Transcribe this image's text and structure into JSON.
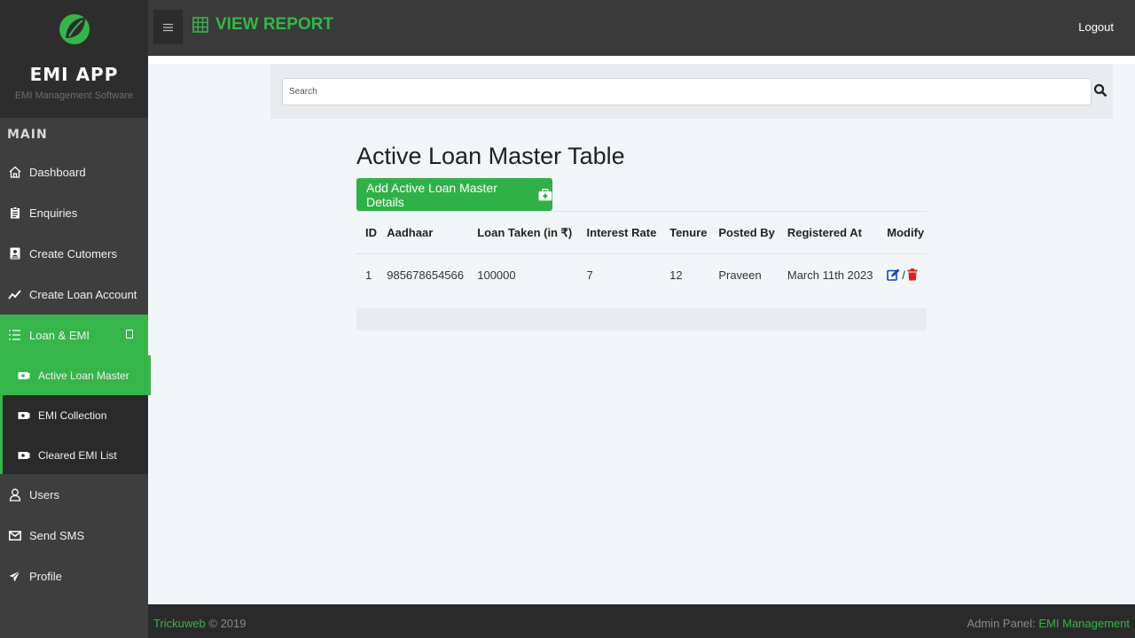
{
  "brand": {
    "title": "EMI APP",
    "subtitle": "EMI Management Software"
  },
  "sidebar": {
    "section_label": "MAIN",
    "items": [
      {
        "label": "Dashboard",
        "icon": "home-icon"
      },
      {
        "label": "Enquiries",
        "icon": "clipboard-icon"
      },
      {
        "label": "Create Cutomers",
        "icon": "id-card-icon"
      },
      {
        "label": "Create Loan Account",
        "icon": "chart-line-icon"
      },
      {
        "label": "Loan & EMI",
        "icon": "list-icon",
        "active": true
      },
      {
        "label": "Users",
        "icon": "user-icon"
      },
      {
        "label": "Send SMS",
        "icon": "envelope-icon"
      },
      {
        "label": "Profile",
        "icon": "paper-plane-icon"
      }
    ],
    "sub_items": [
      {
        "label": "Active Loan Master",
        "icon": "money-icon",
        "active": true
      },
      {
        "label": "EMI Collection",
        "icon": "money-icon"
      },
      {
        "label": "Cleared EMI List",
        "icon": "money-icon"
      }
    ]
  },
  "topbar": {
    "title": "VIEW REPORT",
    "logout": "Logout"
  },
  "search": {
    "placeholder": "Search",
    "value": ""
  },
  "main": {
    "title": "Active Loan Master Table",
    "add_button": "Add Active Loan Master Details",
    "columns": [
      "ID",
      "Aadhaar",
      "Loan Taken (in ₹)",
      "Interest Rate",
      "Tenure",
      "Posted By",
      "Registered At",
      "Modify"
    ],
    "rows": [
      {
        "id": "1",
        "aadhaar": "985678654566",
        "loan": "100000",
        "interest": "7",
        "tenure": "12",
        "posted_by": "Praveen",
        "registered_at": "March 11th 2023",
        "separator": "/"
      }
    ]
  },
  "footer": {
    "left_link": "Trickuweb",
    "left_text": " © 2019",
    "right_text": "Admin Panel: ",
    "right_link": "EMI Management"
  },
  "colors": {
    "accent": "#36b54a",
    "sidebar": "#3e3e3e",
    "topbar": "#3a3a3a",
    "edit": "#1a3fbf",
    "delete": "#e02020"
  }
}
